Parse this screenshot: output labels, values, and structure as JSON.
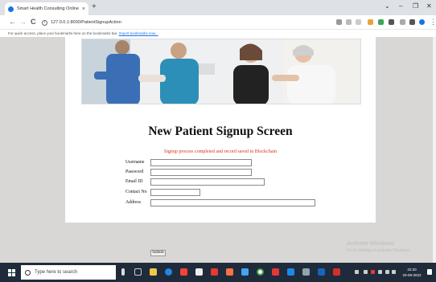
{
  "browser": {
    "tab_title": "Smart Health Consulting Online",
    "tab_close": "×",
    "new_tab": "+",
    "url": "127.0.0.1:8000/PatientSignupAction",
    "bookmark_text": "For quick access, place your bookmarks here on the bookmarks bar.",
    "bookmark_link": "Import bookmarks now...",
    "window_controls": [
      "⌄",
      "–",
      "❐",
      "✕"
    ],
    "nav": {
      "back": "←",
      "forward": "→",
      "reload": "C",
      "menu": "⋮"
    }
  },
  "page": {
    "heading": "New Patient Signup Screen",
    "status_message": "Signup process completed and record saved in Blockchain",
    "fields": [
      {
        "label": "Username",
        "value": ""
      },
      {
        "label": "Password",
        "value": ""
      },
      {
        "label": "Email ID",
        "value": ""
      },
      {
        "label": "Contact No",
        "value": ""
      },
      {
        "label": "Address",
        "value": ""
      }
    ],
    "submit_label": "Submit"
  },
  "watermark": {
    "title": "Activate Windows",
    "subtitle": "Go to Settings to activate Windows."
  },
  "taskbar": {
    "search_placeholder": "Type here to search",
    "time": "22:20",
    "date": "20-09-2022"
  },
  "colors": {
    "status": "#d93025",
    "taskbar": "#1f2b3a",
    "page_bg": "#d9d7d6"
  }
}
